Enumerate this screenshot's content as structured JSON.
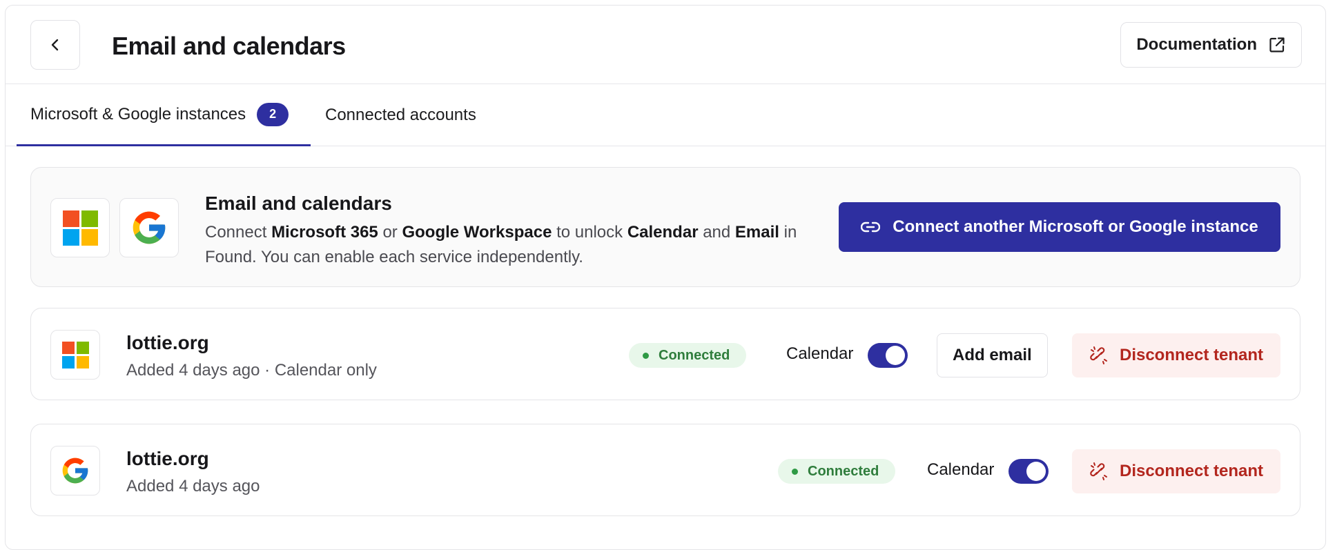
{
  "colors": {
    "accent": "#2e2fa0",
    "success_text": "#2f7d3c",
    "success_bg": "#e8f7ea",
    "danger_text": "#b3261e",
    "danger_bg": "#fdf0ef",
    "ms_red": "#f25022",
    "ms_green": "#7fba00",
    "ms_blue": "#00a4ef",
    "ms_yellow": "#ffb900"
  },
  "header": {
    "back_icon": "chevron-left-icon",
    "title": "Email and calendars",
    "documentation_label": "Documentation",
    "documentation_icon": "external-link-icon"
  },
  "tabs": [
    {
      "label": "Microsoft & Google instances",
      "badge": "2",
      "active": true
    },
    {
      "label": "Connected accounts",
      "active": false
    }
  ],
  "intro": {
    "title": "Email and calendars",
    "desc_part1": "Connect ",
    "desc_b1": "Microsoft 365",
    "desc_part2": " or ",
    "desc_b2": "Google Workspace",
    "desc_part3": " to unlock ",
    "desc_b3": "Calendar",
    "desc_part4": " and ",
    "desc_b4": "Email",
    "desc_part5": " in Found. You can enable each service independently.",
    "connect_button_label": "Connect another Microsoft or Google instance",
    "connect_button_icon": "link-icon"
  },
  "tenants": [
    {
      "provider": "microsoft",
      "name": "lottie.org",
      "meta": "Added 4 days ago · Calendar only",
      "status": "Connected",
      "calendar_label": "Calendar",
      "calendar_enabled": true,
      "add_email_label": "Add email",
      "disconnect_label": "Disconnect tenant",
      "disconnect_icon": "broken-link-icon"
    },
    {
      "provider": "google",
      "name": "lottie.org",
      "meta": "Added 4 days ago",
      "status": "Connected",
      "calendar_label": "Calendar",
      "calendar_enabled": true,
      "disconnect_label": "Disconnect tenant",
      "disconnect_icon": "broken-link-icon"
    }
  ]
}
